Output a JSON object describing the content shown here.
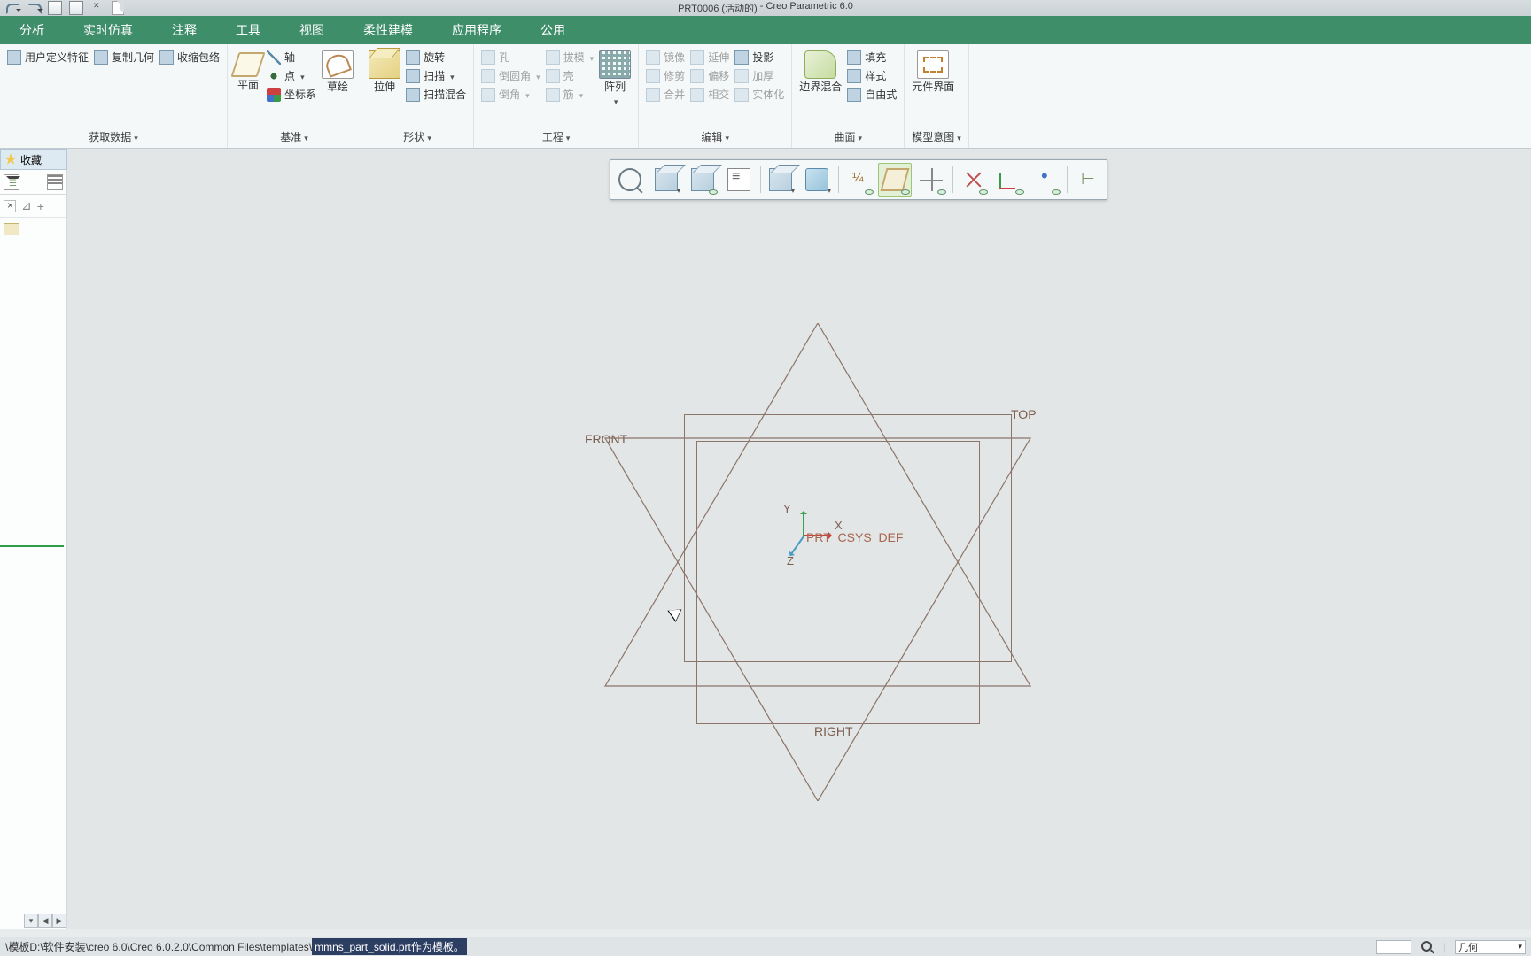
{
  "title": {
    "doc": "PRT0006 (活动的)",
    "app": "Creo Parametric 6.0",
    "sep": " - "
  },
  "menu": {
    "tabs": [
      "分析",
      "实时仿真",
      "注释",
      "工具",
      "视图",
      "柔性建模",
      "应用程序",
      "公用"
    ]
  },
  "ribbon": {
    "groups": [
      {
        "label": "获取数据",
        "dd": true,
        "items": [
          {
            "t": "h",
            "l": "用户定义特征",
            "icon": "udf"
          },
          {
            "t": "h",
            "l": "复制几何",
            "icon": "copygeo"
          },
          {
            "t": "h",
            "l": "收缩包络",
            "icon": "shrink"
          }
        ]
      },
      {
        "label": "基准",
        "dd": true,
        "items": [
          {
            "t": "v",
            "l": "平面",
            "big": "plane"
          },
          {
            "t": "col",
            "rows": [
              {
                "l": "轴",
                "icon": "axis"
              },
              {
                "l": "点",
                "icon": "pt",
                "dd": true
              },
              {
                "l": "坐标系",
                "icon": "csys"
              }
            ]
          },
          {
            "t": "v",
            "l": "草绘",
            "big": "sketch"
          }
        ]
      },
      {
        "label": "形状",
        "dd": true,
        "items": [
          {
            "t": "v",
            "l": "拉伸",
            "big": "extrude"
          },
          {
            "t": "col",
            "rows": [
              {
                "l": "旋转",
                "icon": "rev"
              },
              {
                "l": "扫描",
                "icon": "sweep",
                "dd": true
              },
              {
                "l": "扫描混合",
                "icon": "swblend"
              }
            ]
          }
        ]
      },
      {
        "label": "工程",
        "dd": true,
        "items": [
          {
            "t": "col",
            "rows": [
              {
                "l": "孔",
                "icon": "hole",
                "dis": true
              },
              {
                "l": "倒圆角",
                "icon": "round",
                "dd": true,
                "dis": true
              },
              {
                "l": "倒角",
                "icon": "chamfer",
                "dd": true,
                "dis": true
              }
            ]
          },
          {
            "t": "col",
            "rows": [
              {
                "l": "拔模",
                "icon": "draft",
                "dd": true,
                "dis": true
              },
              {
                "l": "壳",
                "icon": "shell",
                "dis": true
              },
              {
                "l": "筋",
                "icon": "rib",
                "dd": true,
                "dis": true
              }
            ]
          },
          {
            "t": "v",
            "l": "阵列",
            "big": "pattern",
            "dd": true
          }
        ]
      },
      {
        "label": "编辑",
        "dd": true,
        "items": [
          {
            "t": "col",
            "rows": [
              {
                "l": "镜像",
                "icon": "mirror",
                "dis": true
              },
              {
                "l": "修剪",
                "icon": "trim",
                "dis": true
              },
              {
                "l": "合并",
                "icon": "merge",
                "dis": true
              }
            ]
          },
          {
            "t": "col",
            "rows": [
              {
                "l": "延伸",
                "icon": "extend",
                "dis": true
              },
              {
                "l": "偏移",
                "icon": "offset",
                "dis": true
              },
              {
                "l": "相交",
                "icon": "intersect",
                "dis": true
              }
            ]
          },
          {
            "t": "col",
            "rows": [
              {
                "l": "投影",
                "icon": "project"
              },
              {
                "l": "加厚",
                "icon": "thicken",
                "dis": true
              },
              {
                "l": "实体化",
                "icon": "solidify",
                "dis": true
              }
            ]
          }
        ]
      },
      {
        "label": "曲面",
        "dd": true,
        "items": [
          {
            "t": "v",
            "l": "边界混合",
            "big": "bblend"
          },
          {
            "t": "col",
            "rows": [
              {
                "l": "填充",
                "icon": "fill"
              },
              {
                "l": "样式",
                "icon": "style"
              },
              {
                "l": "自由式",
                "icon": "freestyle"
              }
            ]
          }
        ]
      },
      {
        "label": "模型意图",
        "dd": true,
        "items": [
          {
            "t": "v",
            "l": "元件界面",
            "big": "compui"
          }
        ]
      }
    ]
  },
  "favorites": {
    "label": "收藏"
  },
  "left_panel": {
    "nav_btns": [
      "◀",
      "▶",
      "▶"
    ]
  },
  "float_toolbar": {
    "buttons": [
      {
        "name": "refit",
        "ico": "i-refit"
      },
      {
        "name": "named-views",
        "ico": "i-cube",
        "dd": true
      },
      {
        "name": "view-manager",
        "ico": "i-cube",
        "extra": "eye"
      },
      {
        "name": "layers",
        "ico": "i-list"
      },
      {
        "name": "disp-style",
        "ico": "i-cube",
        "dd": true,
        "sep": true
      },
      {
        "name": "disp-style2",
        "ico": "i-disp",
        "dd": true
      },
      {
        "name": "annot-disp",
        "ico": "i-annot",
        "extra": "eye",
        "sep": true
      },
      {
        "name": "plane-disp",
        "ico": "i-plane-sm",
        "extra": "eye",
        "active": true
      },
      {
        "name": "axis-disp",
        "ico": "i-axis",
        "extra": "eye"
      },
      {
        "name": "point-disp",
        "ico": "i-cancel",
        "extra": "eye",
        "sep": true
      },
      {
        "name": "csys-disp",
        "ico": "i-csys-sm",
        "extra": "eye"
      },
      {
        "name": "pt-disp",
        "ico": "i-pt-sm",
        "extra": "eye"
      },
      {
        "name": "model-tree",
        "ico": "i-tree",
        "sep": true
      }
    ]
  },
  "datums": {
    "top": "TOP",
    "front": "FRONT",
    "right": "RIGHT",
    "csys": "PRT_CSYS_DEF",
    "x": "X",
    "y": "Y",
    "z": "Z"
  },
  "status": {
    "pre": "\\模板D:\\软件安装\\creo 6.0\\Creo 6.0.2.0\\Common Files\\templates\\",
    "hl": "mmns_part_solid.prt作为模板。",
    "filter": "几何"
  }
}
